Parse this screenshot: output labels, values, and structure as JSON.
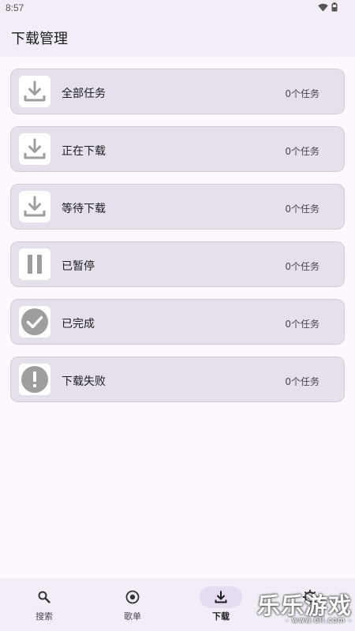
{
  "status_bar": {
    "time": "8:57"
  },
  "header": {
    "title": "下载管理"
  },
  "categories": [
    {
      "label": "全部任务",
      "count": "0个任务",
      "icon": "download-icon"
    },
    {
      "label": "正在下载",
      "count": "0个任务",
      "icon": "download-icon"
    },
    {
      "label": "等待下载",
      "count": "0个任务",
      "icon": "download-icon"
    },
    {
      "label": "已暂停",
      "count": "0个任务",
      "icon": "pause-icon"
    },
    {
      "label": "已完成",
      "count": "0个任务",
      "icon": "check-circle-icon"
    },
    {
      "label": "下载失败",
      "count": "0个任务",
      "icon": "alert-circle-icon"
    }
  ],
  "bottom_nav": [
    {
      "label": "搜索",
      "icon": "search-icon",
      "active": false
    },
    {
      "label": "歌单",
      "icon": "disc-icon",
      "active": false
    },
    {
      "label": "下载",
      "icon": "download-icon",
      "active": true
    },
    {
      "label": "",
      "icon": "gear-icon",
      "active": false
    }
  ],
  "watermark": {
    "main": "乐乐游戏",
    "sub": "- www.6ll.com -"
  },
  "colors": {
    "background": "#fdf8fd",
    "bar": "#f2edf6",
    "card": "#e6e0ec",
    "card_border": "#d3ccdb",
    "icon_gray": "#9e9e9e",
    "nav_active_pill": "#e5dcef"
  }
}
